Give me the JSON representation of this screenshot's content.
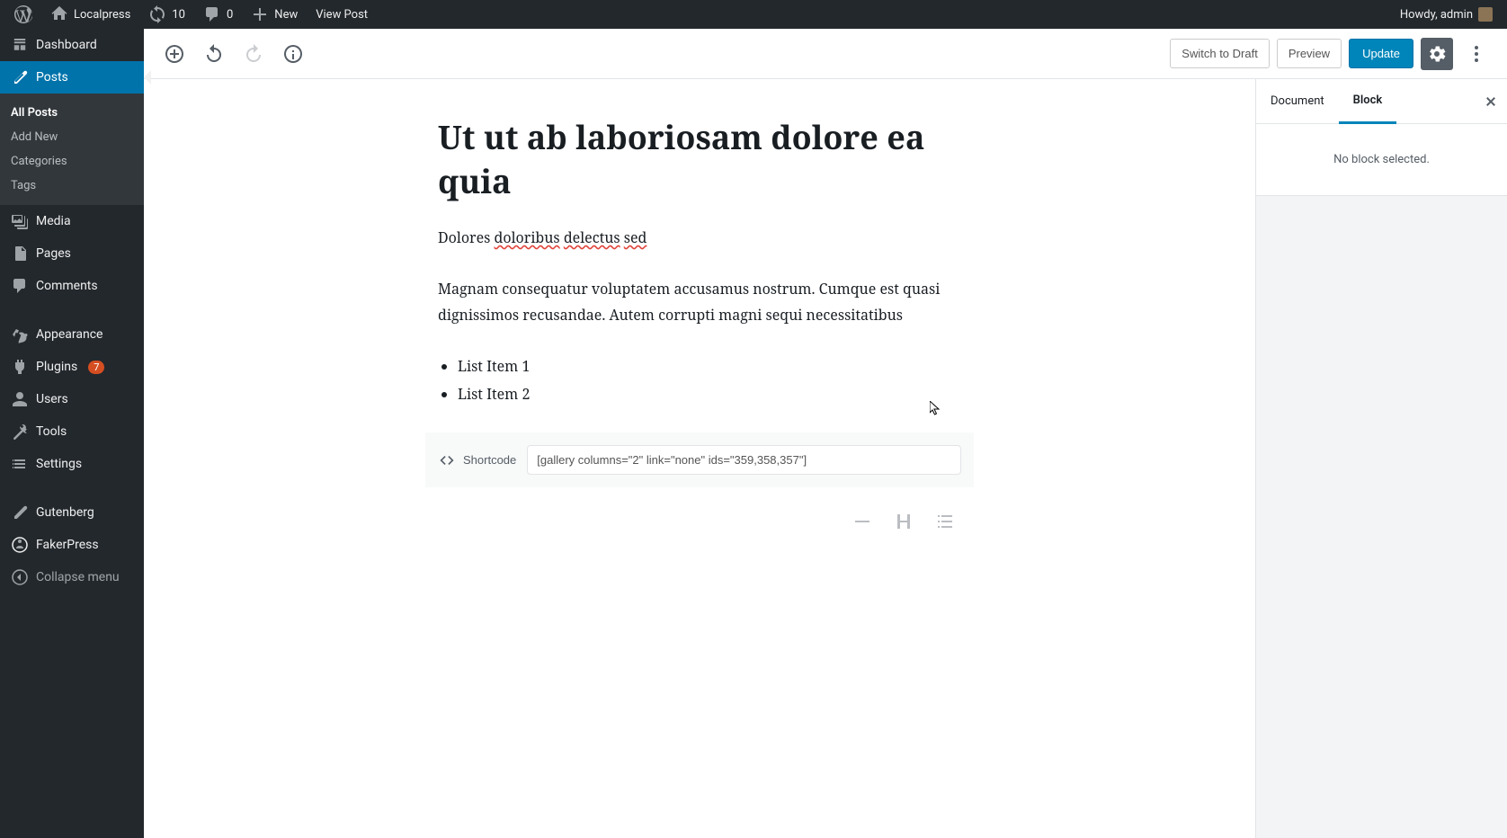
{
  "adminbar": {
    "site_name": "Localpress",
    "updates": "10",
    "comments": "0",
    "new_label": "New",
    "view_post": "View Post",
    "howdy": "Howdy, admin"
  },
  "sidebar": {
    "dashboard": "Dashboard",
    "posts": "Posts",
    "all_posts": "All Posts",
    "add_new": "Add New",
    "categories": "Categories",
    "tags": "Tags",
    "media": "Media",
    "pages": "Pages",
    "comments": "Comments",
    "appearance": "Appearance",
    "plugins": "Plugins",
    "plugins_badge": "7",
    "users": "Users",
    "tools": "Tools",
    "settings": "Settings",
    "gutenberg": "Gutenberg",
    "fakerpress": "FakerPress",
    "collapse": "Collapse menu"
  },
  "header": {
    "switch_draft": "Switch to Draft",
    "preview": "Preview",
    "update": "Update"
  },
  "post": {
    "title": "Ut ut ab laboriosam dolore ea quia",
    "p1_pre": "Dolores ",
    "p1_e1": "doloribus",
    "p1_s1": " ",
    "p1_e2": "delectus",
    "p1_s2": " ",
    "p1_e3": "sed",
    "p2": "Magnam consequatur voluptatem accusamus nostrum. Cumque est quasi dignissimos recusandae. Autem corrupti magni sequi necessitatibus",
    "li1": "List Item 1",
    "li2": "List Item 2",
    "shortcode_label": "Shortcode",
    "shortcode_value": "[gallery columns=\"2\" link=\"none\" ids=\"359,358,357\"]"
  },
  "panel": {
    "document": "Document",
    "block": "Block",
    "no_block": "No block selected."
  }
}
